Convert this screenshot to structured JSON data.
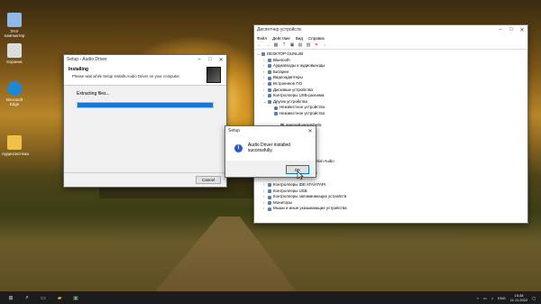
{
  "desktop": {
    "icons": [
      {
        "label": "Этот компьютер",
        "color": "#8fb9e8"
      },
      {
        "label": "Корзина",
        "color": "#dcdcdc"
      },
      {
        "label": "Microsoft Edge",
        "color": "#1e88d6"
      },
      {
        "label": "Аудиосистема",
        "color": "#f0c04a"
      }
    ]
  },
  "setup_window": {
    "title": "Setup - Audio Driver",
    "heading": "Installing",
    "subheading": "Please wait while Setup installs Audio Driver on your computer.",
    "status": "Extracting files...",
    "progress_percent": 100,
    "cancel_label": "Cancel"
  },
  "devmgr_window": {
    "title": "Диспетчер устройств",
    "menu": [
      "Файл",
      "Действие",
      "Вид",
      "Справка"
    ],
    "rows": [
      {
        "label": "DESKTOP-1IUNL2B",
        "indent": 0,
        "chev": "v"
      },
      {
        "label": "Bluetooth",
        "indent": 1,
        "chev": ">"
      },
      {
        "label": "Аудиовходы и аудиовыходы",
        "indent": 1,
        "chev": ">"
      },
      {
        "label": "Батареи",
        "indent": 1,
        "chev": ">"
      },
      {
        "label": "Видеоадаптеры",
        "indent": 1,
        "chev": ">"
      },
      {
        "label": "Встроенное ПО",
        "indent": 1,
        "chev": ">"
      },
      {
        "label": "Дисковые устройства",
        "indent": 1,
        "chev": ">"
      },
      {
        "label": "Контроллеры USB-разъема",
        "indent": 1,
        "chev": ">"
      },
      {
        "label": "Другие устройства",
        "indent": 1,
        "chev": "v"
      },
      {
        "label": "Неизвестное устройство",
        "indent": 2,
        "chev": ""
      },
      {
        "label": "Неизвестное устройство",
        "indent": 2,
        "chev": ""
      },
      {
        "label": "",
        "indent": 2,
        "chev": ""
      },
      {
        "label": "ический интерфейс",
        "indent": 3,
        "chev": ""
      },
      {
        "label": "ойства",
        "indent": 3,
        "chev": ""
      },
      {
        "label": "ойства",
        "indent": 3,
        "chev": ""
      },
      {
        "label": "ые устройства",
        "indent": 3,
        "chev": ""
      },
      {
        "label": "Microsoft",
        "indent": 3,
        "chev": ""
      },
      {
        "label": "оройства",
        "indent": 3,
        "chev": ""
      },
      {
        "label": "рокой High Definition Audio",
        "indent": 3,
        "chev": ""
      },
      {
        "label": "",
        "indent": 3,
        "chev": ""
      },
      {
        "label": "ное обеспечение",
        "indent": 3,
        "chev": ""
      },
      {
        "label": "",
        "indent": 3,
        "chev": ""
      },
      {
        "label": "Контроллеры IDE ATA/ATAPI",
        "indent": 1,
        "chev": ">"
      },
      {
        "label": "Контроллеры USB",
        "indent": 1,
        "chev": ">"
      },
      {
        "label": "Контроллеры запоминающих устройств",
        "indent": 1,
        "chev": ">"
      },
      {
        "label": "Мониторы",
        "indent": 1,
        "chev": ">"
      },
      {
        "label": "Мыши и иные указывающие устройства",
        "indent": 1,
        "chev": ">"
      }
    ]
  },
  "dialog": {
    "title": "Setup",
    "message": "Audio Driver installed successfully.",
    "ok_label": "OK"
  },
  "taskbar": {
    "lang": "ENG",
    "time": "15:38",
    "date": "11.11.2022"
  }
}
